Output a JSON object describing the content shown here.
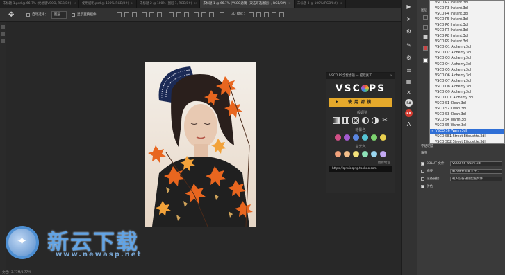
{
  "tabs": [
    {
      "label": "未标题-1.psd @ 66.7% (绝地版VSCO, RGB/8#)",
      "active": false
    },
    {
      "label": "使用说明.psd @ 100%(RGB/8#)",
      "active": false
    },
    {
      "label": "未标题-2 @ 100% (图层 1, RGB/8#)",
      "active": false
    },
    {
      "label": "未标题-1 @ 66.7% (VSCO滤镜（双击可选滤镜）, RGB/8#)",
      "active": true
    },
    {
      "label": "未标题-3 @ 100%(RGB/8#)",
      "active": false
    }
  ],
  "tab_close": "×",
  "options_bar": {
    "tool_icon": "move-tool-icon",
    "auto_select_label": "自动选择：",
    "auto_select_value": "图层",
    "show_transform_label": "显示变换控件",
    "mode_3d_label": "3D 模式："
  },
  "vsco_panel": {
    "title": "VSCO PS全套滤镜 — 提取真工",
    "close": "×",
    "logo_left": "VSC",
    "logo_right": "PS",
    "apply_label": "使用滤镜",
    "apply_icon": "play-icon",
    "section_general": "一般调整",
    "general_tools": [
      "gradient-icon",
      "histogram-icon",
      "contrast-icon",
      "half-circle-icon",
      "levels-icon",
      "scissors-icon"
    ],
    "section_shadow": "暗影色",
    "shadow_colors": [
      "#d24f86",
      "#a35bd1",
      "#5a86e0",
      "#55c4d4",
      "#7cd36f",
      "#e9cf4e"
    ],
    "section_highlight": "高光色",
    "highlight_colors": [
      "#f2a27b",
      "#f5c08b",
      "#f4e27b",
      "#8de2b8",
      "#9ad6ef",
      "#c3a9f2"
    ],
    "update_label": "更新地址",
    "url": "https://qinxiaqing.taobao.com"
  },
  "right_panel": {
    "tab_top": "图层",
    "labels": [
      "图层",
      "通道",
      "路径",
      "调整"
    ],
    "opacity_label": "不透明度",
    "fill_label": "填充",
    "color_label": "颜色",
    "row_3dlut_label": "3DLUT 文件",
    "row_3dlut_value": "VSCO S6 Warm.3dl",
    "row_abstract_label": "摘要",
    "row_abstract_value": "载入摘要配置文件...",
    "row_device_label": "设备链接",
    "row_device_value": "载入设备链接配置文件...",
    "row_dither_label": "仿色"
  },
  "lut_list": [
    "VSCO P2 Instant.3dl",
    "VSCO P3 Instant.3dl",
    "VSCO P4 Instant.3dl",
    "VSCO P5 Instant.3dl",
    "VSCO P6 Instant.3dl",
    "VSCO P7 Instant.3dl",
    "VSCO P8 Instant.3dl",
    "VSCO P9 Instant.3dl",
    "VSCO Q1 Alchemy.3dl",
    "VSCO Q2 Alchemy.3dl",
    "VSCO Q3 Alchemy.3dl",
    "VSCO Q4 Alchemy.3dl",
    "VSCO Q5 Alchemy.3dl",
    "VSCO Q6 Alchemy.3dl",
    "VSCO Q7 Alchemy.3dl",
    "VSCO Q8 Alchemy.3dl",
    "VSCO Q9 Alchemy.3dl",
    "VSCO Q10 Alchemy.3dl",
    "VSCO S1 Clean.3dl",
    "VSCO S2 Clean.3dl",
    "VSCO S3 Clean.3dl",
    "VSCO S4 Warm.3dl",
    "VSCO S5 Warm.3dl",
    "VSCO S6 Warm.3dl",
    "VSCO SE1 Street Etiquette.3dl",
    "VSCO SE2 Street Etiquette.3dl",
    "VSCO SE3 Street Etiquette.3dl",
    "VSCO T1 Moody.3dl"
  ],
  "lut_selected_index": 23,
  "status_bar": "文档：3.77M/3.77M",
  "watermark": {
    "cn": "新云下载",
    "en": "www.newasp.net"
  },
  "colors": {
    "accent": "#e5a92b",
    "selection": "#2f6fd6",
    "workspace": "#282828"
  }
}
